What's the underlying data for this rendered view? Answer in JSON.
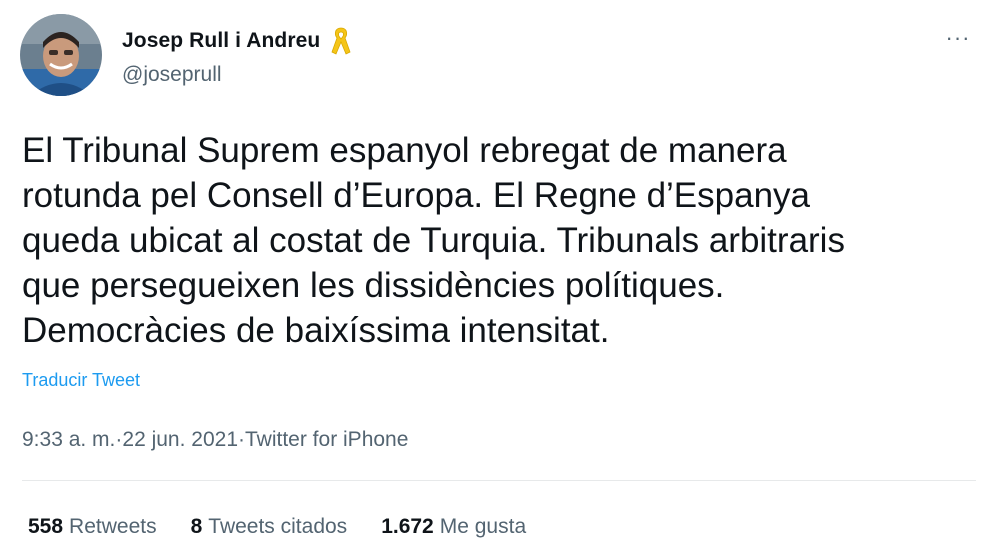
{
  "author": {
    "display_name": "Josep Rull i Andreu",
    "handle": "@joseprull",
    "avatar_icon": "person-avatar",
    "badge_icon": "yellow-ribbon-icon"
  },
  "tweet": {
    "text": "El Tribunal Suprem espanyol rebregat de manera\nrotunda pel Consell d’Europa. El Regne d’Espanya\nqueda ubicat al costat de Turquia. Tribunals arbitraris\nque persegueixen les dissidències polítiques.\nDemocràcies de baixíssima intensitat.",
    "translate_label": "Traducir Tweet",
    "time": "9:33 a. m.",
    "separator": " · ",
    "date": "22 jun. 2021",
    "source": "Twitter for iPhone",
    "more_label": "···"
  },
  "stats": [
    {
      "count": "558",
      "label": "Retweets"
    },
    {
      "count": "8",
      "label": "Tweets citados"
    },
    {
      "count": "1.672",
      "label": "Me gusta"
    }
  ],
  "colors": {
    "link": "#1d9bf0",
    "secondary_text": "#536471",
    "ribbon": "#f5c518"
  }
}
